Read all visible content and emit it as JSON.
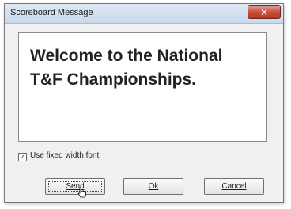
{
  "window": {
    "title": "Scoreboard Message",
    "close_glyph": "✕"
  },
  "message": {
    "text": "Welcome to the National\nT&F Championships."
  },
  "options": {
    "fixed_width_font_label": "Use fixed width font",
    "fixed_width_font_checked": true,
    "check_glyph": "✓"
  },
  "buttons": {
    "send_label": "Send",
    "ok_label": "Ok",
    "cancel_label": "Cancel"
  },
  "icons": {
    "close": "close-icon",
    "checkbox": "check-icon",
    "cursor": "hand-cursor-icon"
  },
  "colors": {
    "close_button": "#c7533f",
    "titlebar": "#c9d9ec"
  }
}
